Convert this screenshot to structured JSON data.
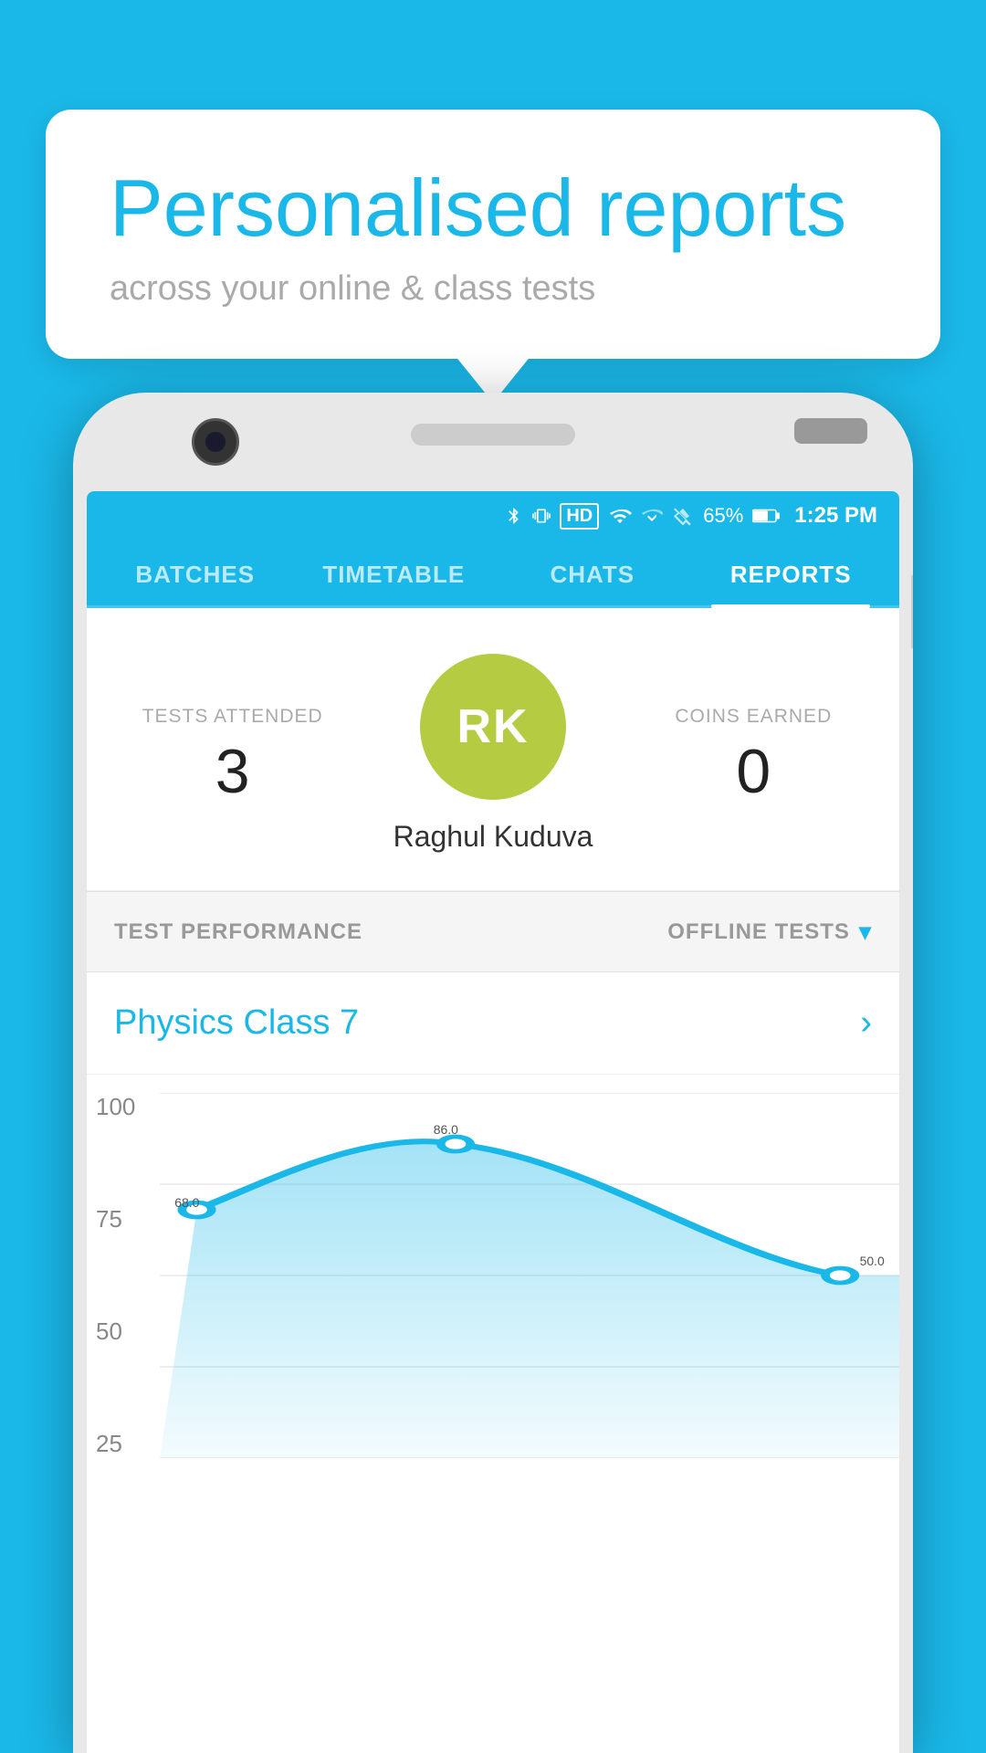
{
  "page": {
    "background_color": "#1ab8e8"
  },
  "bubble": {
    "title": "Personalised reports",
    "subtitle": "across your online & class tests"
  },
  "status_bar": {
    "time": "1:25 PM",
    "battery": "65%"
  },
  "nav_tabs": [
    {
      "id": "batches",
      "label": "BATCHES",
      "active": false
    },
    {
      "id": "timetable",
      "label": "TIMETABLE",
      "active": false
    },
    {
      "id": "chats",
      "label": "CHATS",
      "active": false
    },
    {
      "id": "reports",
      "label": "REPORTS",
      "active": true
    }
  ],
  "user_profile": {
    "initials": "RK",
    "name": "Raghul Kuduva",
    "avatar_color": "#b5cc42"
  },
  "stats": {
    "tests_attended_label": "TESTS ATTENDED",
    "tests_attended_value": "3",
    "coins_earned_label": "COINS EARNED",
    "coins_earned_value": "0"
  },
  "section": {
    "performance_label": "TEST PERFORMANCE",
    "filter_label": "OFFLINE TESTS",
    "chevron": "▾"
  },
  "class_item": {
    "name": "Physics Class 7",
    "arrow": "›"
  },
  "chart": {
    "y_labels": [
      "100",
      "75",
      "50",
      "25"
    ],
    "data_points": [
      {
        "x": 5,
        "y": 68.0,
        "label": "68.0"
      },
      {
        "x": 40,
        "y": 86.0,
        "label": "86.0"
      },
      {
        "x": 92,
        "y": 50.0,
        "label": "50.0"
      }
    ]
  }
}
